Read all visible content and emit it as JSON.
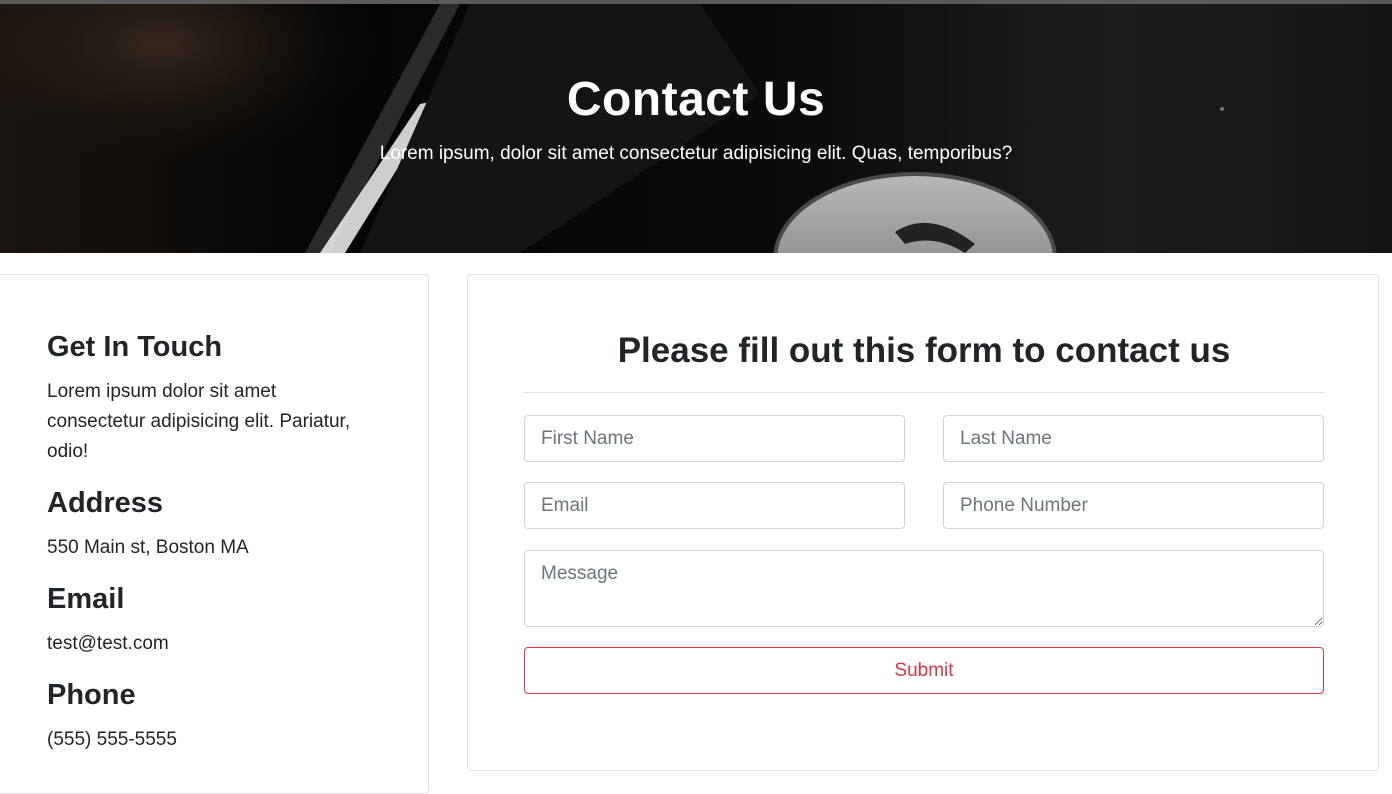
{
  "hero": {
    "title": "Contact Us",
    "subtitle": "Lorem ipsum, dolor sit amet consectetur adipisicing elit. Quas, temporibus?"
  },
  "info": {
    "get_in_touch_heading": "Get In Touch",
    "get_in_touch_text_line1": "Lorem ipsum dolor sit amet",
    "get_in_touch_text_line2": "consectetur adipisicing elit. Pariatur,",
    "get_in_touch_text_line3": "odio!",
    "address_heading": "Address",
    "address_value": "550 Main st, Boston MA",
    "email_heading": "Email",
    "email_value": "test@test.com",
    "phone_heading": "Phone",
    "phone_value": "(555) 555-5555"
  },
  "form": {
    "title": "Please fill out this form to contact us",
    "first_name_placeholder": "First Name",
    "last_name_placeholder": "Last Name",
    "email_placeholder": "Email",
    "phone_placeholder": "Phone Number",
    "message_placeholder": "Message",
    "submit_label": "Submit"
  },
  "colors": {
    "accent": "#dc3545",
    "text": "#212529",
    "border": "#dee2e6"
  }
}
